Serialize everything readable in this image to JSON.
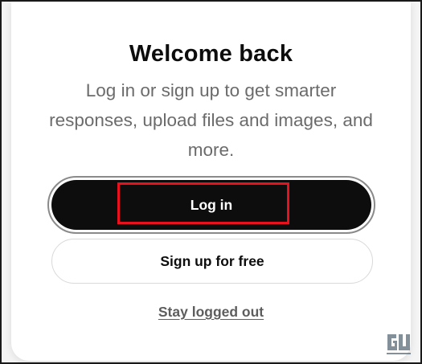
{
  "modal": {
    "title": "Welcome back",
    "subtitle": "Log in or sign up to get smarter responses, upload files and images, and more.",
    "login_label": "Log in",
    "signup_label": "Sign up for free",
    "stay_logged_out_label": "Stay logged out"
  },
  "colors": {
    "primary_button": "#0d0d0d",
    "highlight_box": "#e8121f"
  },
  "watermark": {
    "icon": "gadgets-to-use-logo"
  }
}
